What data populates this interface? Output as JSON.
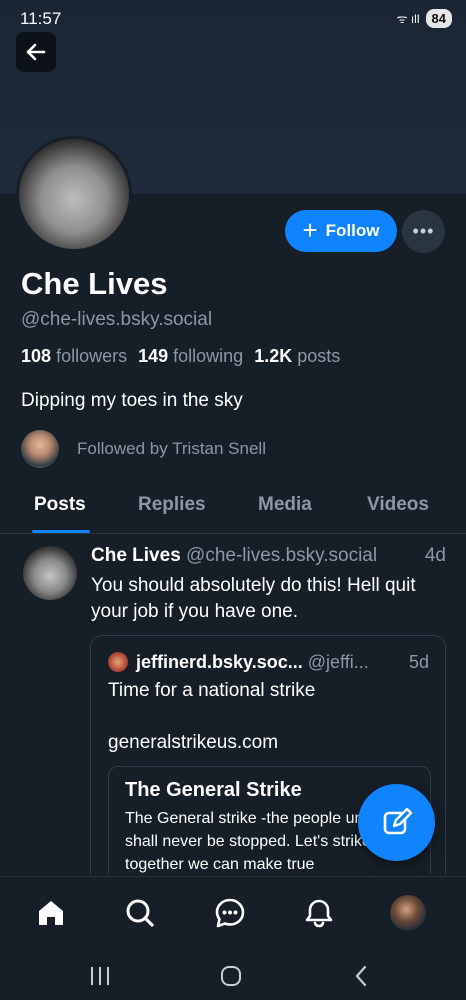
{
  "status_bar": {
    "time": "11:57",
    "battery": "84",
    "signal_glyphs": "ᯤ ıll"
  },
  "profile": {
    "name": "Che Lives",
    "handle": "@che-lives.bsky.social",
    "followers_count": "108",
    "followers_label": "followers",
    "following_count": "149",
    "following_label": "following",
    "posts_count": "1.2K",
    "posts_label": "posts",
    "bio": "Dipping my toes in the sky",
    "followed_by": "Followed by Tristan Snell",
    "follow_label": "Follow",
    "more_label": "•••"
  },
  "tabs": [
    {
      "label": "Posts",
      "active": true
    },
    {
      "label": "Replies",
      "active": false
    },
    {
      "label": "Media",
      "active": false
    },
    {
      "label": "Videos",
      "active": false
    }
  ],
  "post": {
    "author": "Che Lives",
    "handle": "@che-lives.bsky.social",
    "time": "4d",
    "text": "You should absolutely do this!  Hell quit your job if you have one.",
    "quote": {
      "author": "jeffinerd.bsky.soc...",
      "handle": "@jeffi...",
      "time": "5d",
      "text": "Time for a national strike",
      "link": "generalstrikeus.com",
      "embed": {
        "title": "The General Strike",
        "description": "The General strike -the people united shall never be stopped. Let's strike together we can make true"
      }
    }
  },
  "icons": {
    "back": "arrow-left-icon",
    "compose": "compose-icon",
    "home": "home-icon",
    "search": "search-icon",
    "chat": "chat-icon",
    "notifications": "bell-icon"
  },
  "colors": {
    "accent": "#1083fe",
    "background": "#161e27",
    "muted": "#8b98a5"
  }
}
